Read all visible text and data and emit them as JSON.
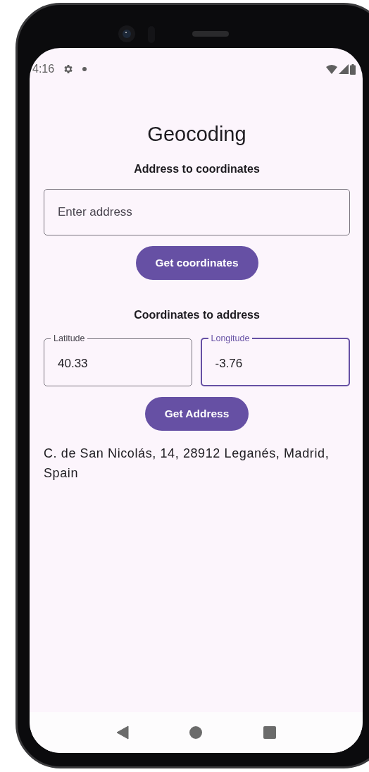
{
  "status_bar": {
    "time": "4:16"
  },
  "title": "Geocoding",
  "address_section": {
    "heading": "Address to coordinates",
    "field": {
      "placeholder": "Enter address"
    },
    "button": "Get coordinates"
  },
  "coordinates_section": {
    "heading": "Coordinates to address",
    "fields": [
      {
        "label": "Latitude",
        "value": "40.33",
        "focused": false
      },
      {
        "label": "Longitude",
        "value": "-3.76",
        "focused": true
      }
    ],
    "button": "Get Address"
  },
  "result": "C. de San Nicolás, 14, 28912 Leganés, Madrid, Spain"
}
